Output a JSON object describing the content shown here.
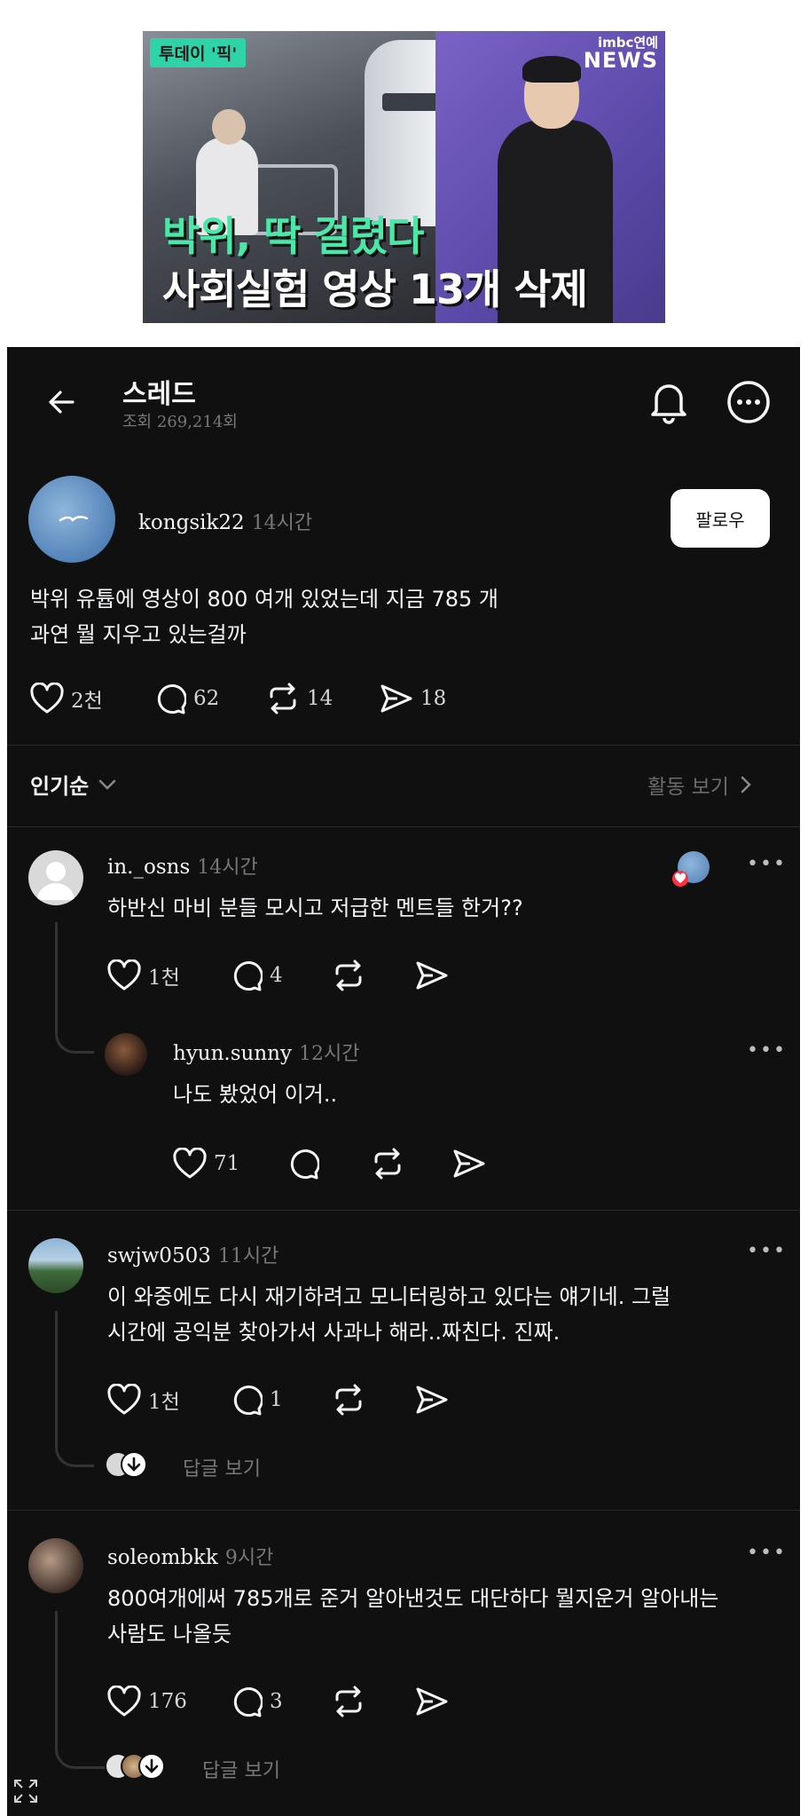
{
  "news": {
    "tag": "투데이 '픽'",
    "logo_top": "imbc연예",
    "logo_bottom": "NEWS",
    "headline_1": "박위, 딱 걸렸다",
    "headline_2": "사회실험 영상 13개 삭제"
  },
  "header": {
    "title": "스레드",
    "views": "조회 269,214회"
  },
  "post": {
    "username": "kongsik22",
    "time": "14시간",
    "follow_label": "팔로우",
    "lines": [
      "박위 유튭에 영상이 800 여개 있었는데 지금 785 개",
      "과연 뭘 지우고 있는걸까"
    ],
    "likes": "2천",
    "comments": "62",
    "reposts": "14",
    "shares": "18"
  },
  "sort": {
    "label": "인기순",
    "activity": "활동 보기"
  },
  "comments": [
    {
      "username": "in._osns",
      "time": "14시간",
      "text": "하반신 마비 분들 모시고 저급한 멘트들 한거??",
      "likes": "1천",
      "replies": "4",
      "dots": "•••"
    },
    {
      "username": "hyun.sunny",
      "time": "12시간",
      "text": "나도 봤었어 이거..",
      "likes": "71",
      "dots": "•••"
    },
    {
      "username": "swjw0503",
      "time": "11시간",
      "lines": [
        "이 와중에도 다시 재기하려고 모니터링하고 있다는 얘기네. 그럴",
        "시간에 공익분 찾아가서 사과나 해라..짜친다. 진짜."
      ],
      "likes": "1천",
      "replies": "1",
      "view_replies": "답글 보기",
      "dots": "•••"
    },
    {
      "username": "soleombkk",
      "time": "9시간",
      "lines": [
        "800여개에써 785개로 준거 알아낸것도 대단하다 뭘지운거 알아내는",
        "사람도 나올듯"
      ],
      "likes": "176",
      "replies": "3",
      "view_replies": "답글 보기",
      "dots": "•••"
    }
  ],
  "colors": {
    "background": "#101010",
    "text": "#f3f5f7",
    "muted": "#777777",
    "accent_green": "#49e7a8"
  }
}
